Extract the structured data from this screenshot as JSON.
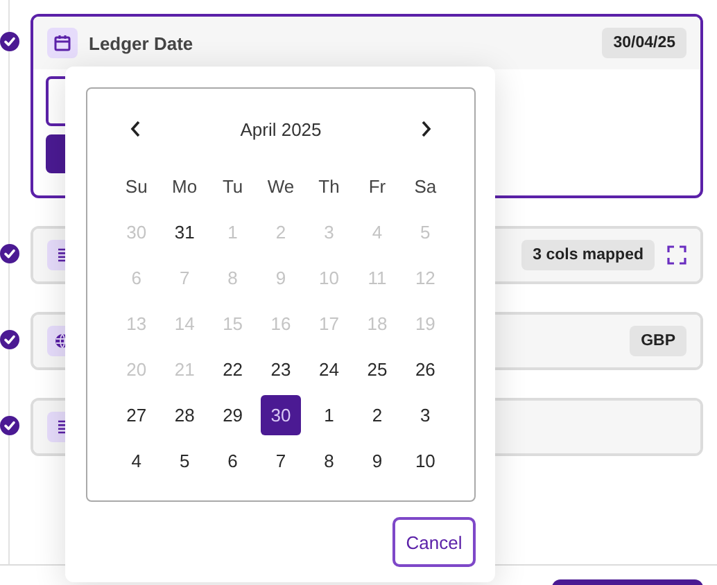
{
  "steps": [
    {
      "done": true,
      "kind": "calendar",
      "title": "Ledger Date",
      "badge": "30/04/25",
      "active": true,
      "expanded": true
    },
    {
      "done": true,
      "kind": "list",
      "badge": "3 cols mapped",
      "expand_icon": true,
      "active": false,
      "expanded": false
    },
    {
      "done": true,
      "kind": "globe",
      "badge": "GBP",
      "active": false,
      "expanded": false
    },
    {
      "done": true,
      "kind": "list",
      "active": false,
      "expanded": false
    }
  ],
  "datepicker": {
    "month": "April 2025",
    "weekdays": [
      "Su",
      "Mo",
      "Tu",
      "We",
      "Th",
      "Fr",
      "Sa"
    ],
    "weeks": [
      [
        {
          "day": "30",
          "muted": true,
          "selected": false
        },
        {
          "day": "31",
          "muted": false,
          "selected": false
        },
        {
          "day": "1",
          "muted": true,
          "selected": false
        },
        {
          "day": "2",
          "muted": true,
          "selected": false
        },
        {
          "day": "3",
          "muted": true,
          "selected": false
        },
        {
          "day": "4",
          "muted": true,
          "selected": false
        },
        {
          "day": "5",
          "muted": true,
          "selected": false
        }
      ],
      [
        {
          "day": "6",
          "muted": true,
          "selected": false
        },
        {
          "day": "7",
          "muted": true,
          "selected": false
        },
        {
          "day": "8",
          "muted": true,
          "selected": false
        },
        {
          "day": "9",
          "muted": true,
          "selected": false
        },
        {
          "day": "10",
          "muted": true,
          "selected": false
        },
        {
          "day": "11",
          "muted": true,
          "selected": false
        },
        {
          "day": "12",
          "muted": true,
          "selected": false
        }
      ],
      [
        {
          "day": "13",
          "muted": true,
          "selected": false
        },
        {
          "day": "14",
          "muted": true,
          "selected": false
        },
        {
          "day": "15",
          "muted": true,
          "selected": false
        },
        {
          "day": "16",
          "muted": true,
          "selected": false
        },
        {
          "day": "17",
          "muted": true,
          "selected": false
        },
        {
          "day": "18",
          "muted": true,
          "selected": false
        },
        {
          "day": "19",
          "muted": true,
          "selected": false
        }
      ],
      [
        {
          "day": "20",
          "muted": true,
          "selected": false
        },
        {
          "day": "21",
          "muted": true,
          "selected": false
        },
        {
          "day": "22",
          "muted": false,
          "selected": false
        },
        {
          "day": "23",
          "muted": false,
          "selected": false
        },
        {
          "day": "24",
          "muted": false,
          "selected": false
        },
        {
          "day": "25",
          "muted": false,
          "selected": false
        },
        {
          "day": "26",
          "muted": false,
          "selected": false
        }
      ],
      [
        {
          "day": "27",
          "muted": false,
          "selected": false
        },
        {
          "day": "28",
          "muted": false,
          "selected": false
        },
        {
          "day": "29",
          "muted": false,
          "selected": false
        },
        {
          "day": "30",
          "muted": false,
          "selected": true
        },
        {
          "day": "1",
          "muted": false,
          "selected": false
        },
        {
          "day": "2",
          "muted": false,
          "selected": false
        },
        {
          "day": "3",
          "muted": false,
          "selected": false
        }
      ],
      [
        {
          "day": "4",
          "muted": false,
          "selected": false
        },
        {
          "day": "5",
          "muted": false,
          "selected": false
        },
        {
          "day": "6",
          "muted": false,
          "selected": false
        },
        {
          "day": "7",
          "muted": false,
          "selected": false
        },
        {
          "day": "8",
          "muted": false,
          "selected": false
        },
        {
          "day": "9",
          "muted": false,
          "selected": false
        },
        {
          "day": "10",
          "muted": false,
          "selected": false
        }
      ]
    ],
    "cancel": "Cancel"
  }
}
